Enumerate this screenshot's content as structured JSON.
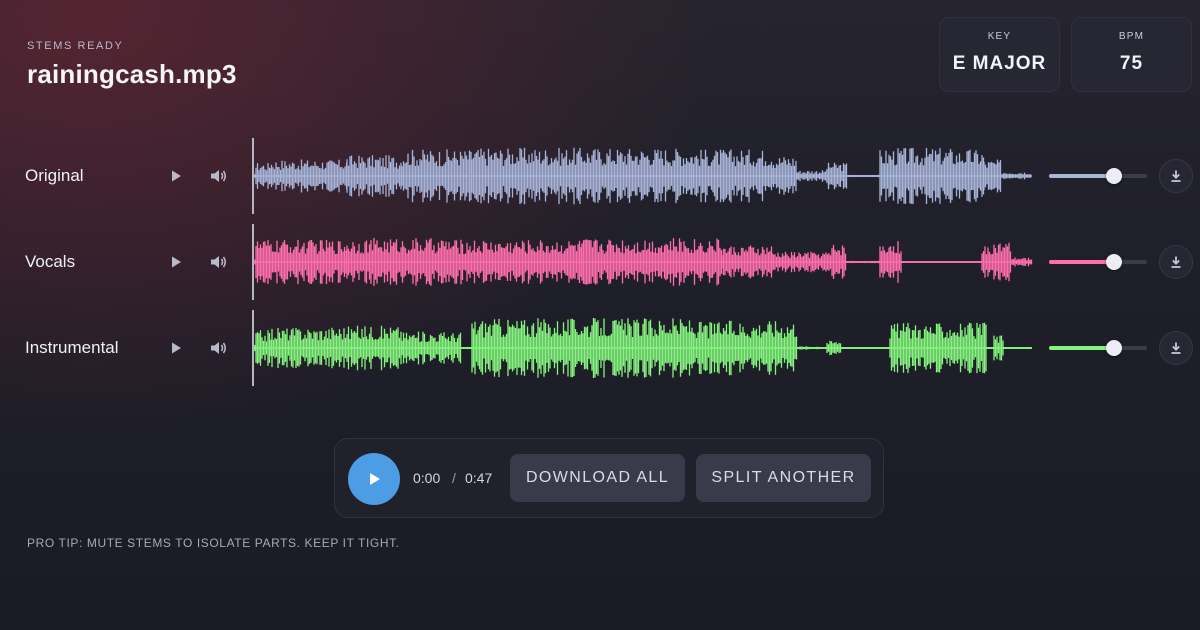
{
  "header": {
    "eyebrow": "STEMS READY",
    "filename": "rainingcash.mp3"
  },
  "stats": {
    "key": {
      "label": "KEY",
      "value": "E MAJOR"
    },
    "bpm": {
      "label": "BPM",
      "value": "75"
    }
  },
  "tracks": [
    {
      "name": "Original",
      "color": "#a8b4d8",
      "volume": 0.66
    },
    {
      "name": "Vocals",
      "color": "#ff6fae",
      "volume": 0.66
    },
    {
      "name": "Instrumental",
      "color": "#86f57f",
      "volume": 0.66
    }
  ],
  "transport": {
    "current_time": "0:00",
    "separator": "/",
    "total_time": "0:47",
    "download_all": "DOWNLOAD ALL",
    "split_another": "SPLIT ANOTHER"
  },
  "tip": "PRO TIP: MUTE STEMS TO ISOLATE PARTS. KEEP IT TIGHT.",
  "icons": {
    "track_play": "play-icon",
    "track_volume": "speaker-icon",
    "track_download": "download-icon",
    "main_play": "play-icon"
  },
  "colors": {
    "accent": "#4d9de5"
  }
}
